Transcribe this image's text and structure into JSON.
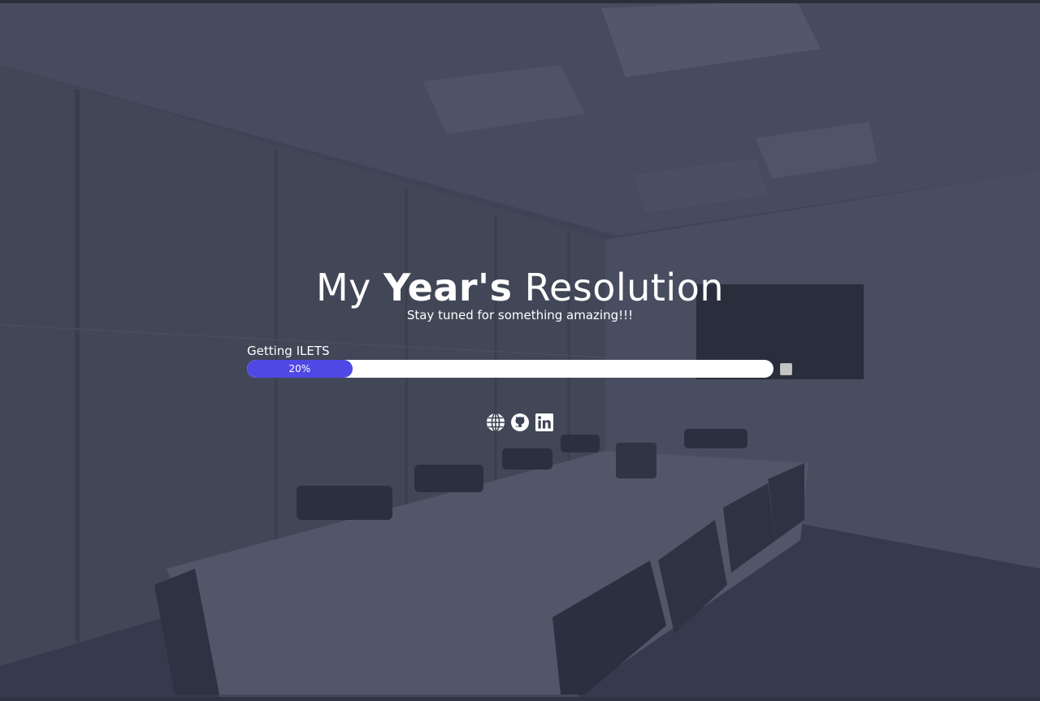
{
  "header": {
    "title_prefix": "My",
    "title_emphasis": "Year's",
    "title_suffix": "Resolution",
    "subtitle": "Stay tuned for something amazing!!!"
  },
  "goals": [
    {
      "label": "Getting ILETS",
      "progress_text": "20%",
      "progress": 0.2,
      "completed": false
    }
  ],
  "social_links": [
    {
      "icon": "globe-icon"
    },
    {
      "icon": "github-icon"
    },
    {
      "icon": "linkedin-icon"
    }
  ],
  "colors": {
    "overlay": "#3c4254",
    "progress_fill": "#5048e5",
    "progress_track": "#ffffff",
    "text": "#ffffff"
  }
}
